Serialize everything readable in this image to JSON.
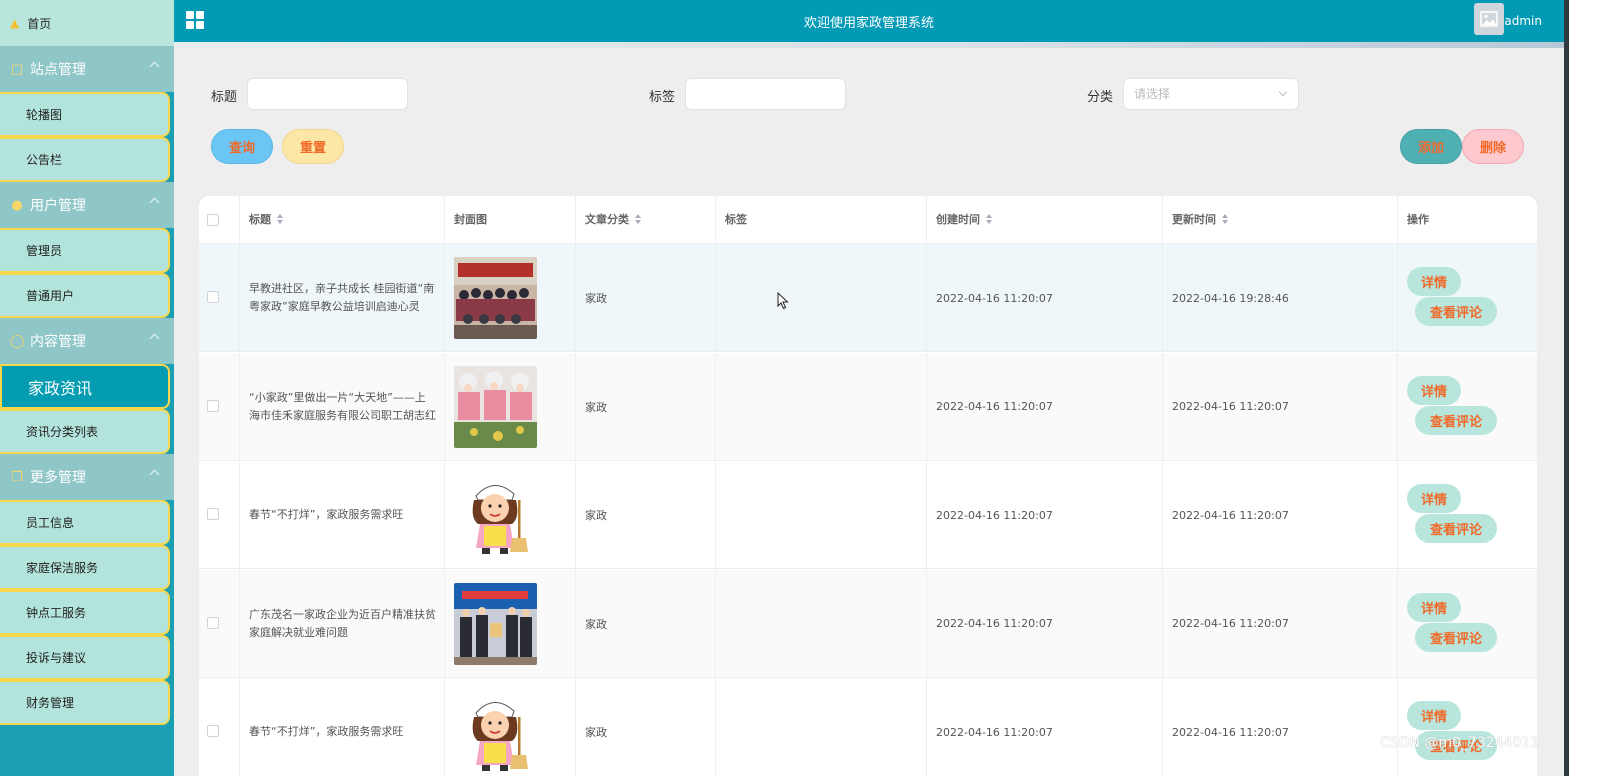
{
  "sidebar": {
    "home": "首页",
    "groups": [
      {
        "title": "站点管理",
        "icon": "monitor-icon",
        "items": [
          "轮播图",
          "公告栏"
        ]
      },
      {
        "title": "用户管理",
        "icon": "user-icon",
        "items": [
          "管理员",
          "普通用户"
        ]
      },
      {
        "title": "内容管理",
        "icon": "chat-icon",
        "items": [
          "家政资讯",
          "资讯分类列表"
        ]
      },
      {
        "title": "更多管理",
        "icon": "copy-icon",
        "items": [
          "员工信息",
          "家庭保洁服务",
          "钟点工服务",
          "投诉与建议",
          "财务管理"
        ]
      }
    ],
    "active_item": "家政资讯"
  },
  "header": {
    "title": "欢迎使用家政管理系统",
    "user": "admin"
  },
  "filters": {
    "title_label": "标题",
    "tag_label": "标签",
    "category_label": "分类",
    "category_placeholder": "请选择"
  },
  "buttons": {
    "search": "查询",
    "reset": "重置",
    "add": "添加",
    "delete": "删除"
  },
  "table": {
    "columns": [
      "标题",
      "封面图",
      "文章分类",
      "标签",
      "创建时间",
      "更新时间",
      "操作"
    ],
    "rows": [
      {
        "title": "早教进社区，亲子共成长 桂园街道“南粤家政”家庭早教公益培训启迪心灵",
        "cover": "group-photo",
        "category": "家政",
        "tag": "",
        "created": "2022-04-16 11:20:07",
        "updated": "2022-04-16 19:28:46"
      },
      {
        "title": "“小家政”里做出一片“大天地”——上海市佳禾家庭服务有限公司职工胡志红",
        "cover": "workers-photo",
        "category": "家政",
        "tag": "",
        "created": "2022-04-16 11:20:07",
        "updated": "2022-04-16 11:20:07"
      },
      {
        "title": "春节“不打烊”，家政服务需求旺",
        "cover": "cleaner-cartoon",
        "category": "家政",
        "tag": "",
        "created": "2022-04-16 11:20:07",
        "updated": "2022-04-16 11:20:07"
      },
      {
        "title": "广东茂名一家政企业为近百户精准扶贫家庭解决就业难问题",
        "cover": "ceremony-photo",
        "category": "家政",
        "tag": "",
        "created": "2022-04-16 11:20:07",
        "updated": "2022-04-16 11:20:07"
      },
      {
        "title": "春节“不打烊”，家政服务需求旺",
        "cover": "cleaner-cartoon",
        "category": "家政",
        "tag": "",
        "created": "2022-04-16 11:20:07",
        "updated": "2022-04-16 11:20:07"
      }
    ],
    "actions": {
      "detail": "详情",
      "comments": "查看评论"
    }
  },
  "watermark": "CSDN @m0_73244011",
  "colors": {
    "header": "#039ab5",
    "sidebar_group": "#8fc7c9",
    "sidebar_item": "#b3e4dc",
    "sidebar_active": "#039cb0",
    "accent_text": "#f06a2a"
  }
}
